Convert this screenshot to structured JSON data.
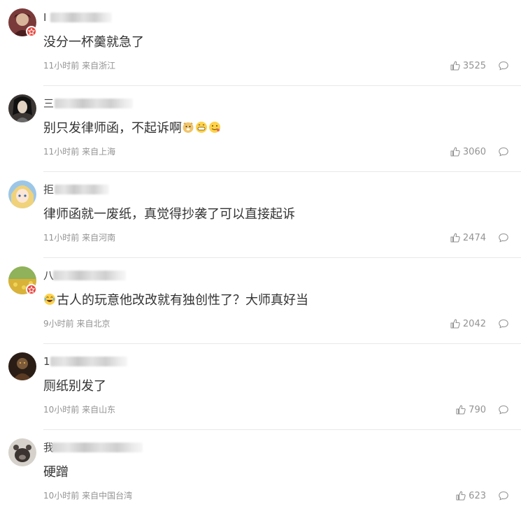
{
  "comments": [
    {
      "name_initial": "I",
      "text": "没分一杯羹就急了",
      "time": "11小时前",
      "location": "来自浙江",
      "likes": "3525",
      "vip_badge": true,
      "avatar_colors": [
        "#5a2a2a",
        "#c4a18a"
      ]
    },
    {
      "name_initial": "三",
      "text": "别只发律师函，不起诉啊",
      "emojis": [
        "doge-icon",
        "grin-icon",
        "drool-icon"
      ],
      "time": "11小时前",
      "location": "来自上海",
      "likes": "3060",
      "vip_badge": false,
      "avatar_colors": [
        "#2a2a2a",
        "#d9c8b8"
      ]
    },
    {
      "name_initial": "拒",
      "text": "律师函就一废纸，真觉得抄袭了可以直接起诉",
      "time": "11小时前",
      "location": "来自河南",
      "likes": "2474",
      "vip_badge": false,
      "avatar_colors": [
        "#e8c97a",
        "#6fa8d6"
      ]
    },
    {
      "name_initial": "八",
      "text": "古人的玩意他改改就有独创性了？大师真好当",
      "emojis_prefix": [
        "laugh-cry-icon"
      ],
      "time": "9小时前",
      "location": "来自北京",
      "likes": "2042",
      "vip_badge": true,
      "avatar_colors": [
        "#c9a83a",
        "#5d8a3a"
      ]
    },
    {
      "name_initial": "1",
      "text": "厕纸别发了",
      "time": "10小时前",
      "location": "来自山东",
      "likes": "790",
      "vip_badge": false,
      "avatar_colors": [
        "#3a2a20",
        "#8a6a3a"
      ]
    },
    {
      "name_initial": "我",
      "text": "硬蹭",
      "time": "10小时前",
      "location": "来自中国台湾",
      "likes": "623",
      "vip_badge": false,
      "avatar_colors": [
        "#cfcac4",
        "#3a3330"
      ]
    }
  ],
  "icons": {
    "like": "thumbs-up-icon",
    "reply": "comment-bubble-icon",
    "vip": "vip-badge-icon"
  },
  "colors": {
    "text": "#333333",
    "meta": "#939393",
    "vip_badge": "#e8453c",
    "divider": "#e8e8e8"
  }
}
